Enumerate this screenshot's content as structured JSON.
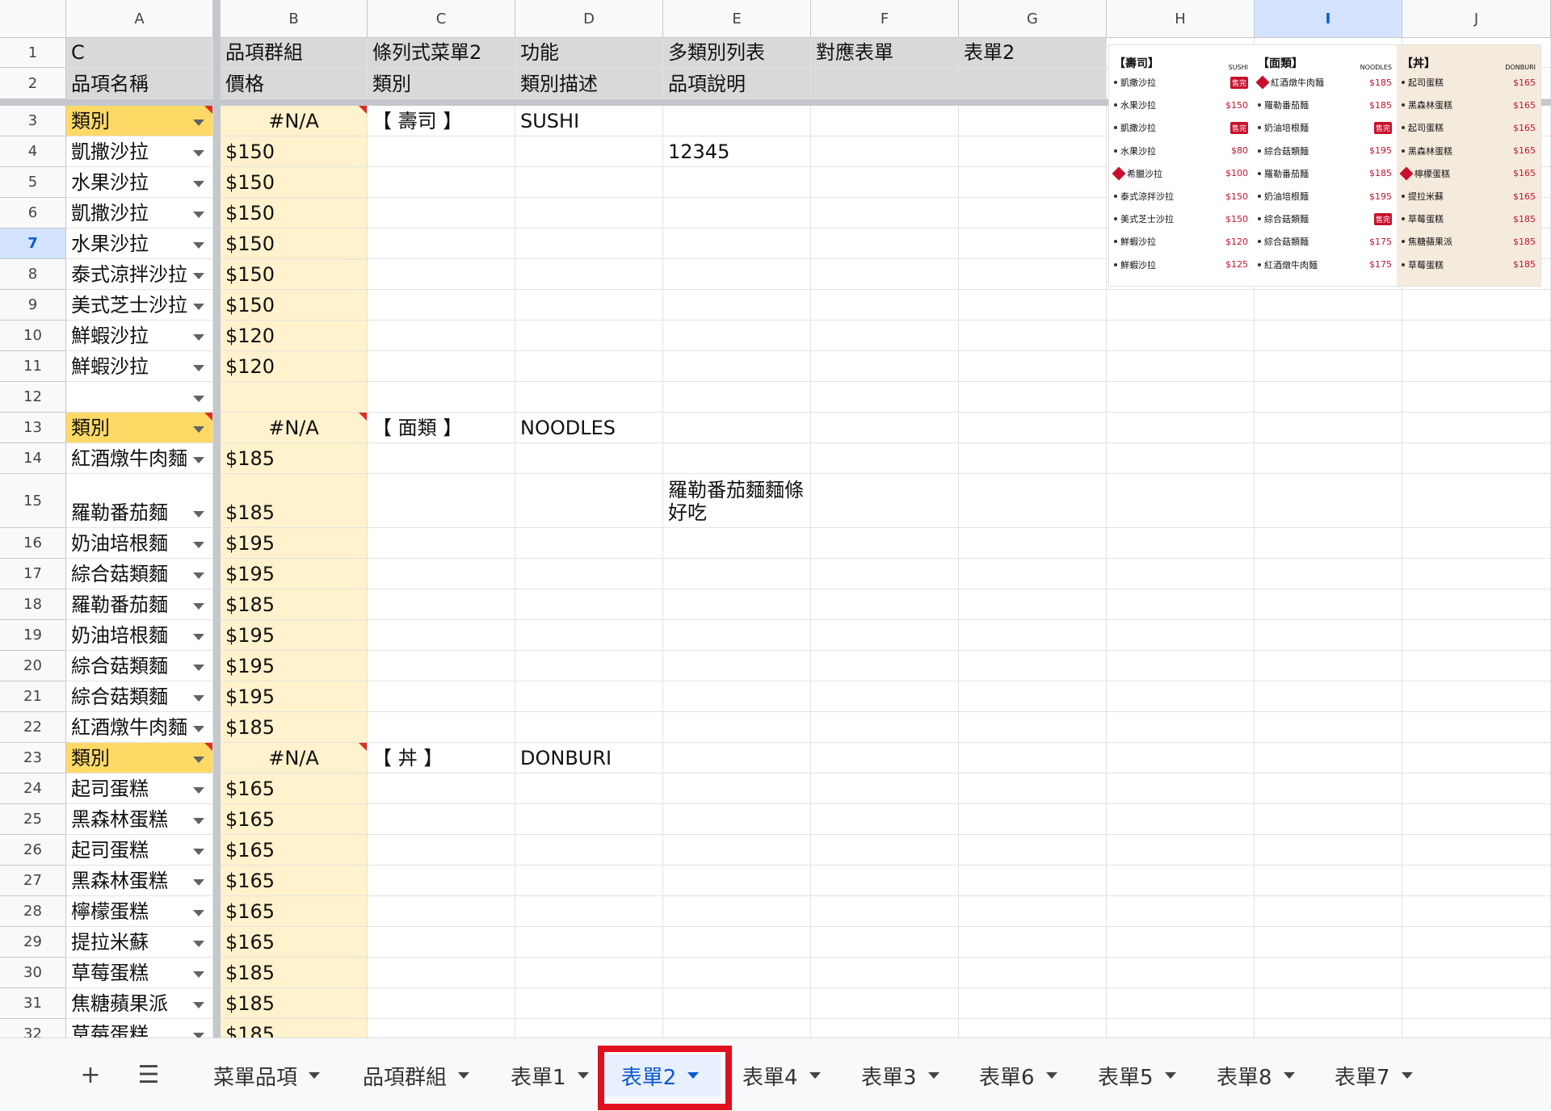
{
  "columns": [
    "A",
    "B",
    "C",
    "D",
    "E",
    "F",
    "G",
    "H",
    "I",
    "J"
  ],
  "selected_column": "I",
  "selected_row": "7",
  "rows": [
    "1",
    "2",
    "3",
    "4",
    "5",
    "6",
    "7",
    "8",
    "9",
    "10",
    "11",
    "12",
    "13",
    "14",
    "15",
    "16",
    "17",
    "18",
    "19",
    "20",
    "21",
    "22",
    "23",
    "24",
    "25",
    "26",
    "27",
    "28",
    "29",
    "30",
    "31",
    "32"
  ],
  "header_rows": {
    "r1": [
      "C",
      "品項群組",
      "條列式菜單2",
      "功能",
      "多類別列表",
      "對應表單",
      "表單2"
    ],
    "r2": [
      "品項名稱",
      "價格",
      "類別",
      "類別描述",
      "品項說明",
      "",
      ""
    ]
  },
  "cells": {
    "A": [
      "類別",
      "凱撒沙拉",
      "水果沙拉",
      "凱撒沙拉",
      "水果沙拉",
      "泰式涼拌沙拉",
      "美式芝士沙拉",
      "鮮蝦沙拉",
      "鮮蝦沙拉",
      "",
      "類別",
      "紅酒燉牛肉麵",
      "羅勒番茄麵",
      "奶油培根麵",
      "綜合菇類麵",
      "羅勒番茄麵",
      "奶油培根麵",
      "綜合菇類麵",
      "綜合菇類麵",
      "紅酒燉牛肉麵",
      "類別",
      "起司蛋糕",
      "黑森林蛋糕",
      "起司蛋糕",
      "黑森林蛋糕",
      "檸檬蛋糕",
      "提拉米蘇",
      "草莓蛋糕",
      "焦糖蘋果派",
      "草莓蛋糕"
    ],
    "B": [
      "#N/A",
      "$150",
      "$150",
      "$150",
      "$150",
      "$150",
      "$150",
      "$120",
      "$120",
      "",
      "#N/A",
      "$185",
      "$185",
      "$195",
      "$195",
      "$185",
      "$195",
      "$195",
      "$195",
      "$185",
      "#N/A",
      "$165",
      "$165",
      "$165",
      "$165",
      "$165",
      "$165",
      "$185",
      "$185",
      "$185"
    ],
    "C3": "【 壽司 】",
    "D3": "SUSHI",
    "E4": "12345",
    "C13": "【 面類 】",
    "D13": "NOODLES",
    "E15": "羅勒番茄麵麵條好吃",
    "C23": "【 丼 】",
    "D23": "DONBURI"
  },
  "menu_preview": {
    "columns": [
      {
        "title": "【壽司】",
        "en": "SUSHI",
        "tan": false,
        "items": [
          {
            "name": "凱撒沙拉",
            "price": "",
            "sold": "售完",
            "hot": false
          },
          {
            "name": "水果沙拉",
            "price": "$150",
            "sold": "",
            "hot": false
          },
          {
            "name": "凱撒沙拉",
            "price": "",
            "sold": "售完",
            "hot": false
          },
          {
            "name": "水果沙拉",
            "price": "$80",
            "sold": "",
            "hot": false
          },
          {
            "name": "希臘沙拉",
            "price": "$100",
            "sold": "",
            "hot": true
          },
          {
            "name": "泰式涼拌沙拉",
            "price": "$150",
            "sold": "",
            "hot": false
          },
          {
            "name": "美式芝士沙拉",
            "price": "$150",
            "sold": "",
            "hot": false
          },
          {
            "name": "鮮蝦沙拉",
            "price": "$120",
            "sold": "",
            "hot": false
          },
          {
            "name": "鮮蝦沙拉",
            "price": "$125",
            "sold": "",
            "hot": false
          }
        ]
      },
      {
        "title": "【面類】",
        "en": "NOODLES",
        "tan": false,
        "items": [
          {
            "name": "紅酒燉牛肉麵",
            "price": "$185",
            "sold": "",
            "hot": true
          },
          {
            "name": "羅勒番茄麵",
            "price": "$185",
            "sold": "",
            "hot": false
          },
          {
            "name": "奶油培根麵",
            "price": "",
            "sold": "售完",
            "hot": false
          },
          {
            "name": "綜合菇類麵",
            "price": "$195",
            "sold": "",
            "hot": false
          },
          {
            "name": "羅勒番茄麵",
            "price": "$185",
            "sold": "",
            "hot": false
          },
          {
            "name": "奶油培根麵",
            "price": "$195",
            "sold": "",
            "hot": false
          },
          {
            "name": "綜合菇類麵",
            "price": "",
            "sold": "售完",
            "hot": false
          },
          {
            "name": "綜合菇類麵",
            "price": "$175",
            "sold": "",
            "hot": false
          },
          {
            "name": "紅酒燉牛肉麵",
            "price": "$175",
            "sold": "",
            "hot": false
          }
        ]
      },
      {
        "title": "【丼】",
        "en": "DONBURI",
        "tan": true,
        "items": [
          {
            "name": "起司蛋糕",
            "price": "$165",
            "sold": "",
            "hot": false
          },
          {
            "name": "黑森林蛋糕",
            "price": "$165",
            "sold": "",
            "hot": false
          },
          {
            "name": "起司蛋糕",
            "price": "$165",
            "sold": "",
            "hot": false
          },
          {
            "name": "黑森林蛋糕",
            "price": "$165",
            "sold": "",
            "hot": false
          },
          {
            "name": "檸檬蛋糕",
            "price": "$165",
            "sold": "",
            "hot": true
          },
          {
            "name": "提拉米蘇",
            "price": "$165",
            "sold": "",
            "hot": false
          },
          {
            "name": "草莓蛋糕",
            "price": "$185",
            "sold": "",
            "hot": false
          },
          {
            "name": "焦糖蘋果派",
            "price": "$185",
            "sold": "",
            "hot": false
          },
          {
            "name": "草莓蛋糕",
            "price": "$185",
            "sold": "",
            "hot": false
          }
        ]
      }
    ]
  },
  "sheet_tabs": [
    "菜單品項",
    "品項群組",
    "表單1",
    "表單2",
    "表單4",
    "表單3",
    "表單6",
    "表單5",
    "表單8",
    "表單7"
  ],
  "active_tab": "表單2",
  "icons": {
    "add": "plus-icon",
    "all_sheets": "menu-lines-icon"
  },
  "colors": {
    "header_gray": "#d9d9d9",
    "price_yellow": "#fff2cc",
    "category_gold": "#ffd966",
    "active_blue": "#0b57d0",
    "highlight_red": "#e0101e",
    "price_red": "#c8102e"
  }
}
